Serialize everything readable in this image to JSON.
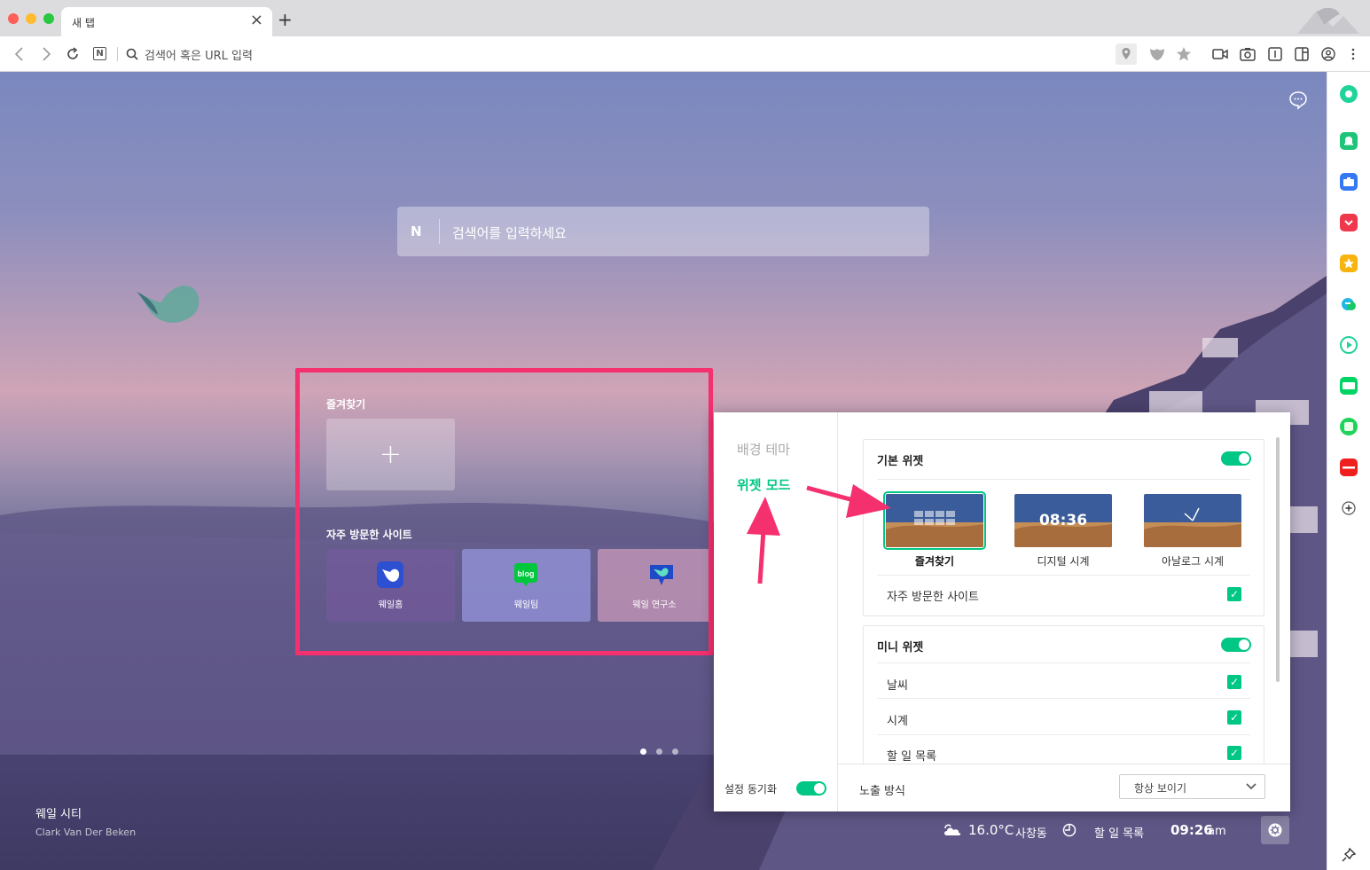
{
  "browser": {
    "tab_title": "새 탭",
    "tab_close": "×",
    "new_tab": "+",
    "address_placeholder": "검색어 혹은 URL 입력",
    "naver_letter": "N"
  },
  "newtab": {
    "search_placeholder": "검색어를 입력하세요",
    "search_logo": "N",
    "favorites_title": "즐겨찾기",
    "add_symbol": "+",
    "frequent_title": "자주 방문한 사이트",
    "frequent_sites": [
      {
        "label": "웨일홈",
        "icon": "whale-home-icon"
      },
      {
        "label": "웨일팀",
        "icon": "blog-icon"
      },
      {
        "label": "웨일 연구소",
        "icon": "whale-lab-icon"
      }
    ],
    "blog_icon_text": "blog",
    "background_title": "웨일 시티",
    "background_author": "Clark Van Der Beken",
    "page_dots": 3,
    "active_dot": 0,
    "weather_temp": "16.0°C",
    "weather_location": "사창동",
    "todo_label": "할 일 목록",
    "clock_time": "09:26",
    "clock_ampm": "am"
  },
  "settings_panel": {
    "menu": [
      "배경 테마",
      "위젯 모드"
    ],
    "active_menu": "위젯 모드",
    "sync_label": "설정 동기화",
    "sync_on": true,
    "basic_widget": {
      "title": "기본 위젯",
      "enabled": true,
      "options": [
        {
          "label": "즐겨찾기",
          "selected": true
        },
        {
          "label": "디지털 시계",
          "selected": false,
          "preview_time": "08:36"
        },
        {
          "label": "아날로그 시계",
          "selected": false
        }
      ],
      "frequent_sites_label": "자주 방문한 사이트",
      "frequent_sites_checked": true
    },
    "mini_widget": {
      "title": "미니 위젯",
      "enabled": true,
      "items": [
        {
          "label": "날씨",
          "checked": true
        },
        {
          "label": "시계",
          "checked": true
        },
        {
          "label": "할 일 목록",
          "checked": true
        }
      ]
    },
    "display_mode_label": "노출 방식",
    "display_mode_value": "항상 보이기",
    "check_mark": "✓"
  },
  "colors": {
    "accent": "#00c785",
    "highlight": "#f5306e"
  },
  "sidebar_icons": [
    "green-circle-icon",
    "alarm-icon",
    "briefcase-icon",
    "pocket-icon",
    "star-icon",
    "translate-icon",
    "play-icon",
    "webtoon-icon",
    "square-icon",
    "now-icon",
    "add-icon",
    "pin-icon"
  ]
}
